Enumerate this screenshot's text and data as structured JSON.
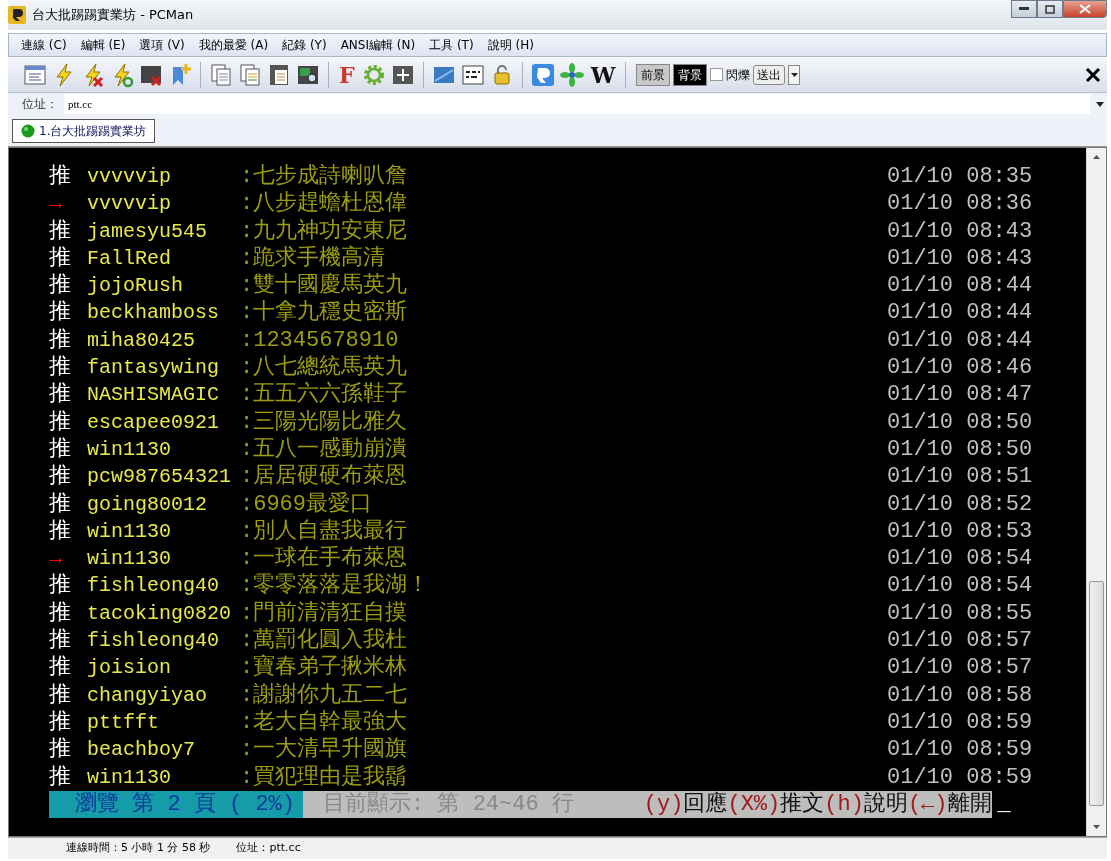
{
  "window": {
    "title": "台大批踢踢實業坊 - PCMan"
  },
  "menu": [
    "連線 (C)",
    "編輯 (E)",
    "選項 (V)",
    "我的最愛 (A)",
    "紀錄 (Y)",
    "ANSI編輯 (N)",
    "工具 (T)",
    "說明 (H)"
  ],
  "toolbar": {
    "font_button": "F",
    "wiki_button": "W"
  },
  "color_bar": {
    "foreground": "前景",
    "background": "背景",
    "blink": {
      "label": "閃爍",
      "checked": false
    },
    "send": "送出"
  },
  "address": {
    "label": "位址：",
    "value": "ptt.cc"
  },
  "tabs": [
    {
      "label": "1.台大批踢踢實業坊",
      "selected": true
    }
  ],
  "comments": [
    {
      "kind": "push",
      "tag": "推",
      "user": "vvvvvip",
      "text": ":七步成詩喇叭詹",
      "time": "01/10 08:35"
    },
    {
      "kind": "arrow",
      "tag": "→",
      "user": "vvvvvip",
      "text": ":八步趕蟾杜恩偉",
      "time": "01/10 08:36"
    },
    {
      "kind": "push",
      "tag": "推",
      "user": "jamesyu545",
      "text": ":九九神功安東尼",
      "time": "01/10 08:43"
    },
    {
      "kind": "push",
      "tag": "推",
      "user": "FallRed",
      "text": ":跪求手機高清",
      "time": "01/10 08:43"
    },
    {
      "kind": "push",
      "tag": "推",
      "user": "jojoRush",
      "text": ":雙十國慶馬英九",
      "time": "01/10 08:44"
    },
    {
      "kind": "push",
      "tag": "推",
      "user": "beckhamboss",
      "text": ":十拿九穩史密斯",
      "time": "01/10 08:44"
    },
    {
      "kind": "push",
      "tag": "推",
      "user": "miha80425",
      "text": ":12345678910",
      "time": "01/10 08:44"
    },
    {
      "kind": "push",
      "tag": "推",
      "user": "fantasywing",
      "text": ":八七總統馬英九",
      "time": "01/10 08:46"
    },
    {
      "kind": "push",
      "tag": "推",
      "user": "NASHISMAGIC",
      "text": ":五五六六孫鞋子",
      "time": "01/10 08:47"
    },
    {
      "kind": "push",
      "tag": "推",
      "user": "escapee0921",
      "text": ":三陽光陽比雅久",
      "time": "01/10 08:50"
    },
    {
      "kind": "push",
      "tag": "推",
      "user": "win1130",
      "text": ":五八一感動崩潰",
      "time": "01/10 08:50"
    },
    {
      "kind": "push",
      "tag": "推",
      "user": "pcw987654321",
      "text": ":居居硬硬布萊恩",
      "time": "01/10 08:51"
    },
    {
      "kind": "push",
      "tag": "推",
      "user": "going80012",
      "text": ":6969最愛口",
      "time": "01/10 08:52"
    },
    {
      "kind": "push",
      "tag": "推",
      "user": "win1130",
      "text": ":別人自盡我最行",
      "time": "01/10 08:53"
    },
    {
      "kind": "arrow",
      "tag": "→",
      "user": "win1130",
      "text": ":一球在手布萊恩",
      "time": "01/10 08:54"
    },
    {
      "kind": "push",
      "tag": "推",
      "user": "fishleong40",
      "text": ":零零落落是我湖！",
      "time": "01/10 08:54"
    },
    {
      "kind": "push",
      "tag": "推",
      "user": "tacoking0820",
      "text": ":門前清清狂自摸",
      "time": "01/10 08:55"
    },
    {
      "kind": "push",
      "tag": "推",
      "user": "fishleong40",
      "text": ":萬罰化圓入我杜",
      "time": "01/10 08:57"
    },
    {
      "kind": "push",
      "tag": "推",
      "user": "joision",
      "text": ":寶春弟子揪米林",
      "time": "01/10 08:57"
    },
    {
      "kind": "push",
      "tag": "推",
      "user": "changyiyao",
      "text": ":謝謝你九五二七",
      "time": "01/10 08:58"
    },
    {
      "kind": "push",
      "tag": "推",
      "user": "pttfft",
      "text": ":老大自幹最強大",
      "time": "01/10 08:59"
    },
    {
      "kind": "push",
      "tag": "推",
      "user": "beachboy7",
      "text": ":一大清早升國旗",
      "time": "01/10 08:59"
    },
    {
      "kind": "push",
      "tag": "推",
      "user": "win1130",
      "text": ":買犯理由是我鬍",
      "time": "01/10 08:59"
    }
  ],
  "footer": {
    "page": "瀏覽 第 2 頁 (  2%)",
    "range": "目前顯示: 第 24~46 行",
    "keys": [
      {
        "key": "(y)",
        "label": "回應"
      },
      {
        "key": "(X%)",
        "label": "推文"
      },
      {
        "key": "(h)",
        "label": "說明"
      },
      {
        "key": "(←)",
        "label": "離開"
      }
    ],
    "cursor": "_"
  },
  "status_bar": {
    "connection_time": "連線時間：5 小時 1 分 58 秒",
    "address": "位址：ptt.cc"
  }
}
